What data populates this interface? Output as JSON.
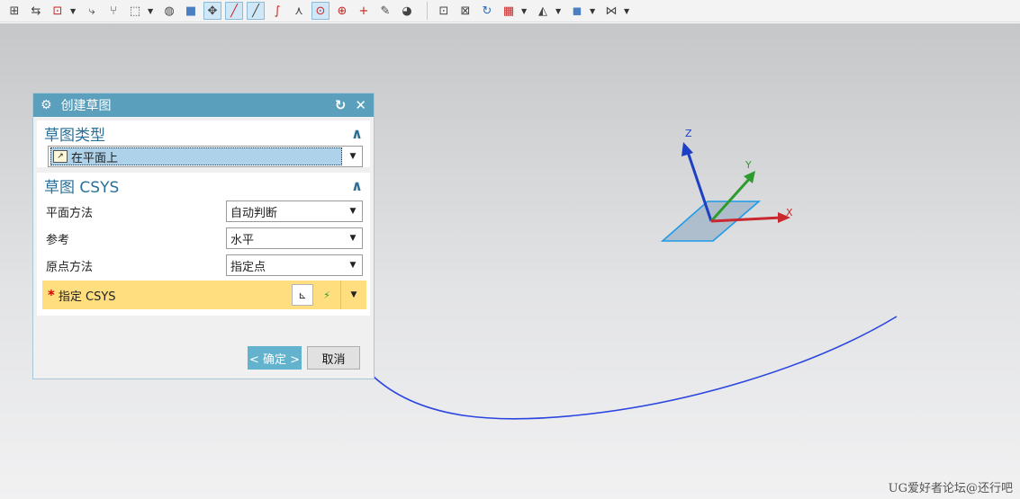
{
  "toolbar": {
    "icons_left": [
      "snap-view-icon",
      "move-icon",
      "point-snap-icon",
      "routing-icon",
      "tree-icon",
      "selection-box-icon",
      "shaded-icon",
      "solid-box-icon",
      "end-point-icon",
      "line-icon",
      "line-through-icon",
      "curve-icon",
      "intersection-icon",
      "center-circle-icon",
      "arc-center-icon",
      "crosshair-icon",
      "pencil-icon",
      "edit-icon"
    ],
    "icons_right": [
      "fit-view-icon",
      "zoom-icon",
      "rotate-icon",
      "layout-icon",
      "render-style-icon",
      "cube-icon",
      "view-orient-icon"
    ]
  },
  "dialog": {
    "title": "创建草图",
    "type_section": {
      "heading": "草图类型",
      "selected": "在平面上"
    },
    "csys_section": {
      "heading": "草图 CSYS",
      "rows": [
        {
          "label": "平面方法",
          "value": "自动判断"
        },
        {
          "label": "参考",
          "value": "水平"
        },
        {
          "label": "原点方法",
          "value": "指定点"
        }
      ],
      "specify_label": "指定 CSYS"
    },
    "ok_label": "< 确定 >",
    "cancel_label": "取消"
  },
  "triad": {
    "x": "X",
    "y": "Y",
    "z": "Z"
  },
  "watermark": "UG爱好者论坛@还行吧"
}
